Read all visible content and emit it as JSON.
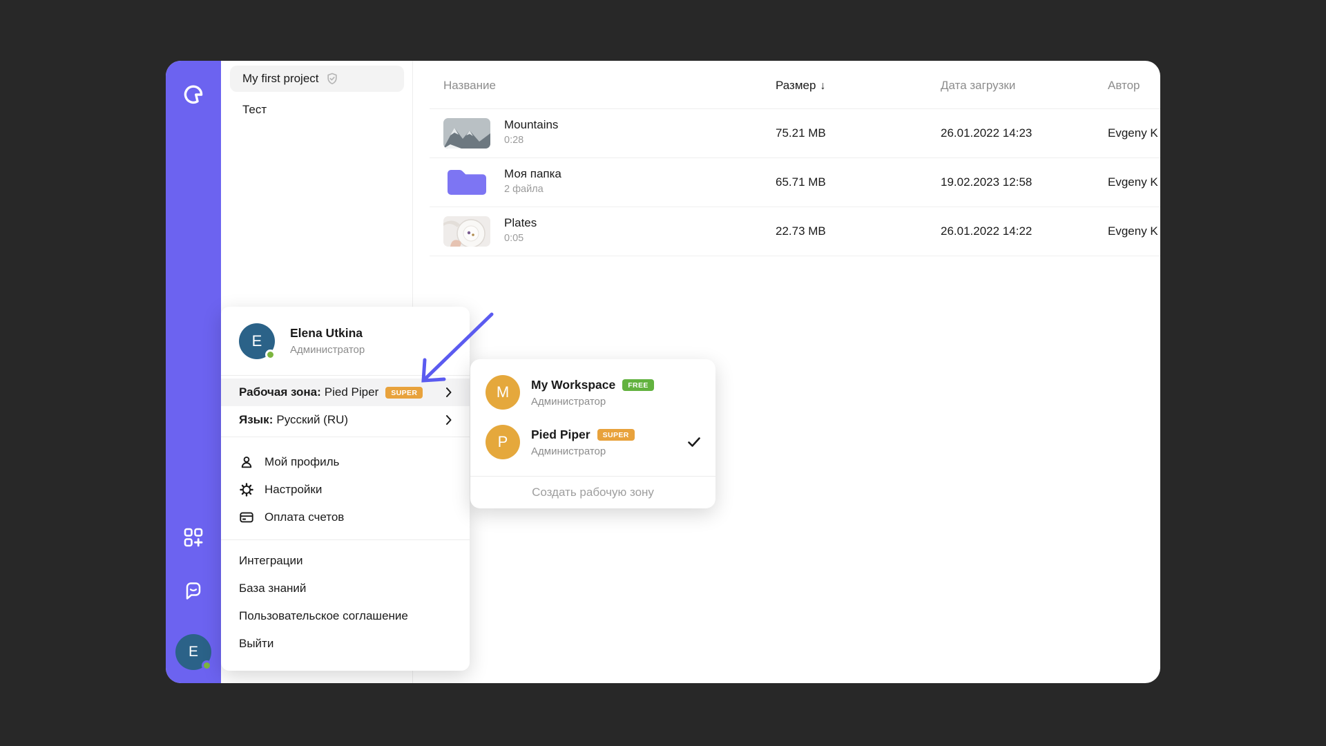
{
  "colors": {
    "sidebar": "#6C63F0",
    "badge_super": "#E8A23C",
    "badge_free": "#62B23F",
    "user_avatar": "#2B6288",
    "workspace_avatar": "#E5A83C",
    "online_dot": "#7CB53F",
    "annotation_arrow": "#5B5BF0"
  },
  "sidebar": {
    "avatar_initial": "E"
  },
  "projects": {
    "items": [
      {
        "label": "My first project"
      },
      {
        "label": "Тест"
      }
    ]
  },
  "table": {
    "headers": {
      "name": "Название",
      "size": "Размер",
      "date": "Дата загрузки",
      "author": "Автор"
    },
    "sort_indicator": "↓",
    "rows": [
      {
        "name": "Mountains",
        "meta": "0:28",
        "size": "75.21 MB",
        "date": "26.01.2022 14:23",
        "author": "Evgeny K"
      },
      {
        "name": "Моя папка",
        "meta": "2 файла",
        "size": "65.71 MB",
        "date": "19.02.2023 12:58",
        "author": "Evgeny K"
      },
      {
        "name": "Plates",
        "meta": "0:05",
        "size": "22.73 MB",
        "date": "26.01.2022 14:22",
        "author": "Evgeny K"
      }
    ]
  },
  "user_menu": {
    "user": {
      "name": "Elena Utkina",
      "role": "Администратор",
      "initial": "E"
    },
    "workspace_item": {
      "label": "Рабочая зона:",
      "value": "Pied Piper",
      "badge": "SUPER"
    },
    "language_item": {
      "label": "Язык:",
      "value": "Русский (RU)"
    },
    "items_icons": [
      {
        "label": "Мой профиль"
      },
      {
        "label": "Настройки"
      },
      {
        "label": "Оплата счетов"
      }
    ],
    "items_links": [
      {
        "label": "Интеграции"
      },
      {
        "label": "База знаний"
      },
      {
        "label": "Пользовательское соглашение"
      },
      {
        "label": "Выйти"
      }
    ]
  },
  "workspace_menu": {
    "items": [
      {
        "name": "My Workspace",
        "badge": "FREE",
        "role": "Администратор",
        "initial": "M",
        "checked": false
      },
      {
        "name": "Pied Piper",
        "badge": "SUPER",
        "role": "Администратор",
        "initial": "P",
        "checked": true
      }
    ],
    "create_label": "Создать рабочую зону"
  }
}
